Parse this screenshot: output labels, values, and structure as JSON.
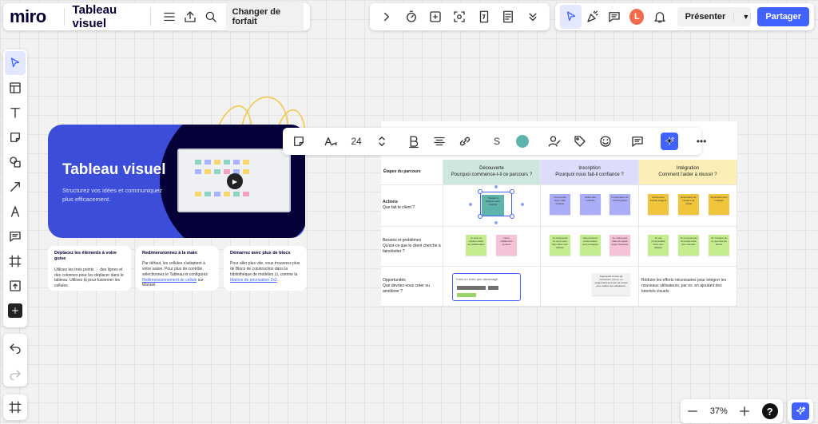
{
  "app": {
    "logo": "miro",
    "board_title": "Tableau visuel",
    "upgrade_label": "Changer de forfait"
  },
  "top_right": {
    "avatar_initial": "L",
    "present_label": "Présenter",
    "share_label": "Partager"
  },
  "zoom": {
    "level": "37%",
    "help": "?"
  },
  "context_toolbar": {
    "font_size": "24",
    "shape_letter": "S",
    "more": "•••",
    "color": "#5fb3ad"
  },
  "hero": {
    "title": "Tableau visuel",
    "subtitle": "Structurez vos idées et communiquez plus efficacement."
  },
  "tips": [
    {
      "title": "Déplacez les éléments à votre guise",
      "body": "Utilisez les trois points ⋮ des lignes et des colonnes pour les déplacer dans le tableau. Utilisez ⊞ pour fusionner les cellules."
    },
    {
      "title": "Redimensionnez à la main",
      "body": "Par défaut, les cellules s'adaptent à votre saisie. Pour plus de contrôle, sélectionnez le Tableau et configurez",
      "link": "Redimensionnement de cellule",
      "tail": "sur Manuel."
    },
    {
      "title": "Démarrez avec plus de blocs",
      "body": "Pour aller plus vite, vous trouverez plus de Blocs de construction dans la bibliothèque de modèles ⊡, comme la",
      "link": "Matrice de priorisation 2x2",
      "tail": "."
    }
  ],
  "journey": {
    "corner": "Étapes du parcours",
    "columns": [
      {
        "title": "Découverte",
        "subtitle": "Pourquoi commence-t-il ce parcours ?",
        "color": "#cfe6df"
      },
      {
        "title": "Inscription",
        "subtitle": "Pourquoi nous fait-il confiance ?",
        "color": "#dcdcfb"
      },
      {
        "title": "Intégration",
        "subtitle": "Comment l'aider à réussir ?",
        "color": "#fbeeb6"
      }
    ],
    "rows": [
      {
        "title": "Actions",
        "subtitle": "Que fait le client ?"
      },
      {
        "title": "Besoins et problèmes",
        "subtitle": "Qu'est-ce que le client cherche à faire/éviter ?"
      },
      {
        "title": "Opportunités",
        "subtitle": "Que devriez-vous créer ou améliorer ?"
      }
    ],
    "stickies": {
      "actions_discovery": "Travaille à distance avec l'équipe",
      "actions_signup": [
        "Commence avec l'offre Gratuite",
        "Utilise des modèles",
        "Confirmation de l'essai gratuit"
      ],
      "actions_integration": [
        "Découverte d'outils intégrés",
        "Exploration de l'espace de travail",
        "Exploration des modèles"
      ],
      "needs_discovery": [
        "Je veux un espace visuel de collaboration",
        "Nous collaborons souvent"
      ],
      "needs_signup": [
        "Je comprends ce qu'on peut faire dans mon tableau",
        "Mes données personnelles sont protégées",
        "Je n'aime pas l'idée du papier avant d'essayer"
      ],
      "needs_integration": [
        "Je suis personnalisé dans mon tableau",
        "Je ne perds pas de temps à lire des manuels",
        "Je m'inspire de ce que font les autres"
      ],
      "opp_signup": "Augmenter le taux de conversion, par ex. en augmentant la durée de l'essai pour évaluer les utilisateurs.",
      "opp_integration": "Réduire les efforts nécessaires pour intégrer les nouveaux utilisateurs, par ex. en ajoutant des tutoriels visuels."
    },
    "widget_title": "Faire en sorte que davantage"
  }
}
